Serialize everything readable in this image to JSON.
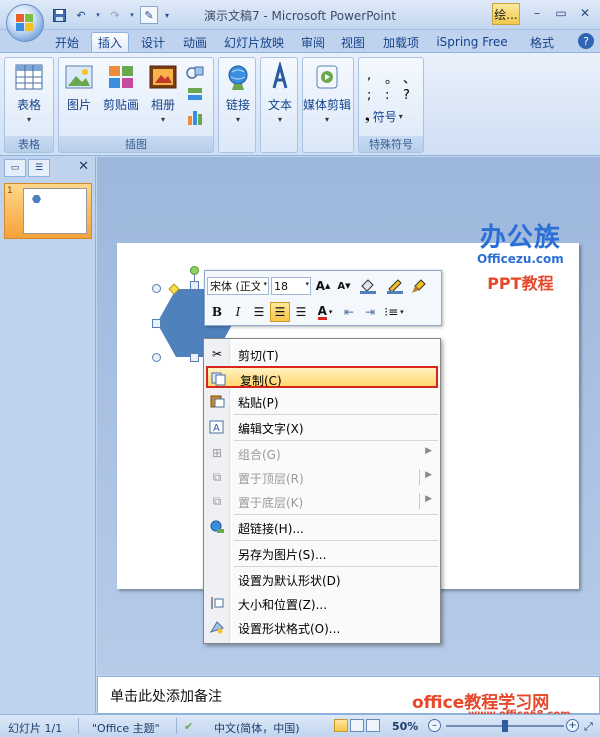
{
  "titlebar": {
    "title": "演示文稿7 - Microsoft PowerPoint",
    "tool_tab": "绘...",
    "minimize": "–",
    "restore": "▭",
    "close": "✕"
  },
  "tabs": [
    {
      "label": "开始"
    },
    {
      "label": "插入"
    },
    {
      "label": "设计"
    },
    {
      "label": "动画"
    },
    {
      "label": "幻灯片放映"
    },
    {
      "label": "审阅"
    },
    {
      "label": "视图"
    },
    {
      "label": "加载项"
    },
    {
      "label": "iSpring Free"
    },
    {
      "label": "格式"
    }
  ],
  "active_tab": "插入",
  "help": "?",
  "ribbon": {
    "groups": {
      "table": {
        "label": "表格",
        "buttons": [
          "表格"
        ]
      },
      "illustrations": {
        "label": "插图",
        "buttons": [
          "图片",
          "剪贴画",
          "相册"
        ]
      },
      "links": {
        "buttons": [
          "链接"
        ]
      },
      "text": {
        "buttons": [
          "文本"
        ]
      },
      "media": {
        "buttons": [
          "媒体剪辑"
        ]
      },
      "symbols": {
        "label": "特殊符号",
        "chars": [
          ",",
          "。",
          "、",
          ";",
          ":",
          "?"
        ],
        "symbol_button": "符号"
      }
    }
  },
  "left_panel": {
    "close": "✕",
    "slide_number": "1"
  },
  "watermark": {
    "brand": "办公族",
    "site": "Officezu.com",
    "ppt": "PPT教程",
    "bottom": "office教程学习网",
    "bottom_url": "www.office68.com"
  },
  "mini_toolbar": {
    "font": "宋体 (正文",
    "size": "18",
    "grow": "A",
    "shrink": "A",
    "bold": "B",
    "italic": "I",
    "font_color": "A"
  },
  "context_menu": {
    "items": [
      {
        "label": "剪切(T)",
        "icon": "scissors-icon"
      },
      {
        "label": "复制(C)",
        "icon": "copy-icon"
      },
      {
        "label": "粘贴(P)",
        "icon": "paste-icon"
      },
      {
        "label": "编辑文字(X)",
        "icon": "edit-text-icon"
      },
      {
        "label": "组合(G)",
        "icon": "group-icon"
      },
      {
        "label": "置于顶层(R)",
        "icon": "bring-front-icon"
      },
      {
        "label": "置于底层(K)",
        "icon": "send-back-icon"
      },
      {
        "label": "超链接(H)...",
        "icon": "hyperlink-icon"
      },
      {
        "label": "另存为图片(S)...",
        "icon": ""
      },
      {
        "label": "设置为默认形状(D)",
        "icon": ""
      },
      {
        "label": "大小和位置(Z)...",
        "icon": "size-position-icon"
      },
      {
        "label": "设置形状格式(O)...",
        "icon": "format-shape-icon"
      }
    ]
  },
  "notes": {
    "placeholder": "单击此处添加备注"
  },
  "status": {
    "slide": "幻灯片 1/1",
    "theme": "\"Office 主题\"",
    "language": "中文(简体，中国)",
    "zoom": "50%",
    "zoom_out": "–",
    "zoom_in": "+"
  }
}
